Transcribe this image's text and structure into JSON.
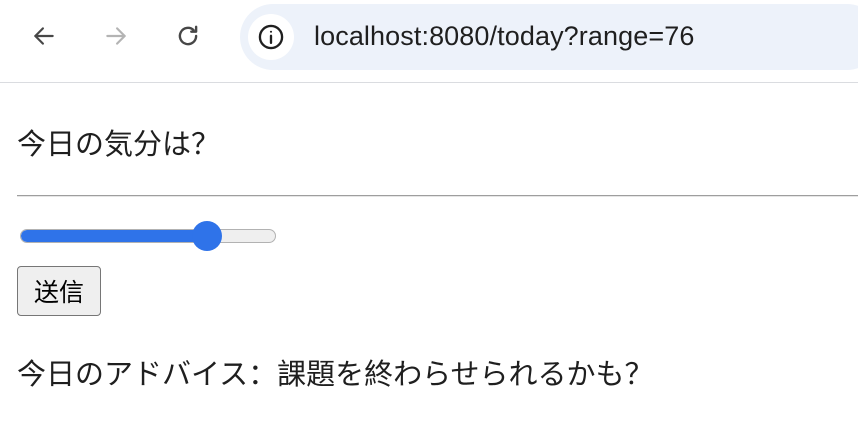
{
  "browser": {
    "url": "localhost:8080/today?range=76",
    "icons": {
      "back": "arrow-left",
      "forward": "arrow-right",
      "reload": "reload",
      "site_info": "info-circle"
    }
  },
  "page": {
    "question": "今日の気分は？",
    "mood_slider": {
      "min": 0,
      "max": 100,
      "value": 76
    },
    "submit_label": "送信",
    "advice": "今日のアドバイス：課題を終わらせられるかも？"
  },
  "colors": {
    "accent": "#2f73e9",
    "omnibox_bg": "#edf2fa",
    "button_bg": "#efefef"
  }
}
